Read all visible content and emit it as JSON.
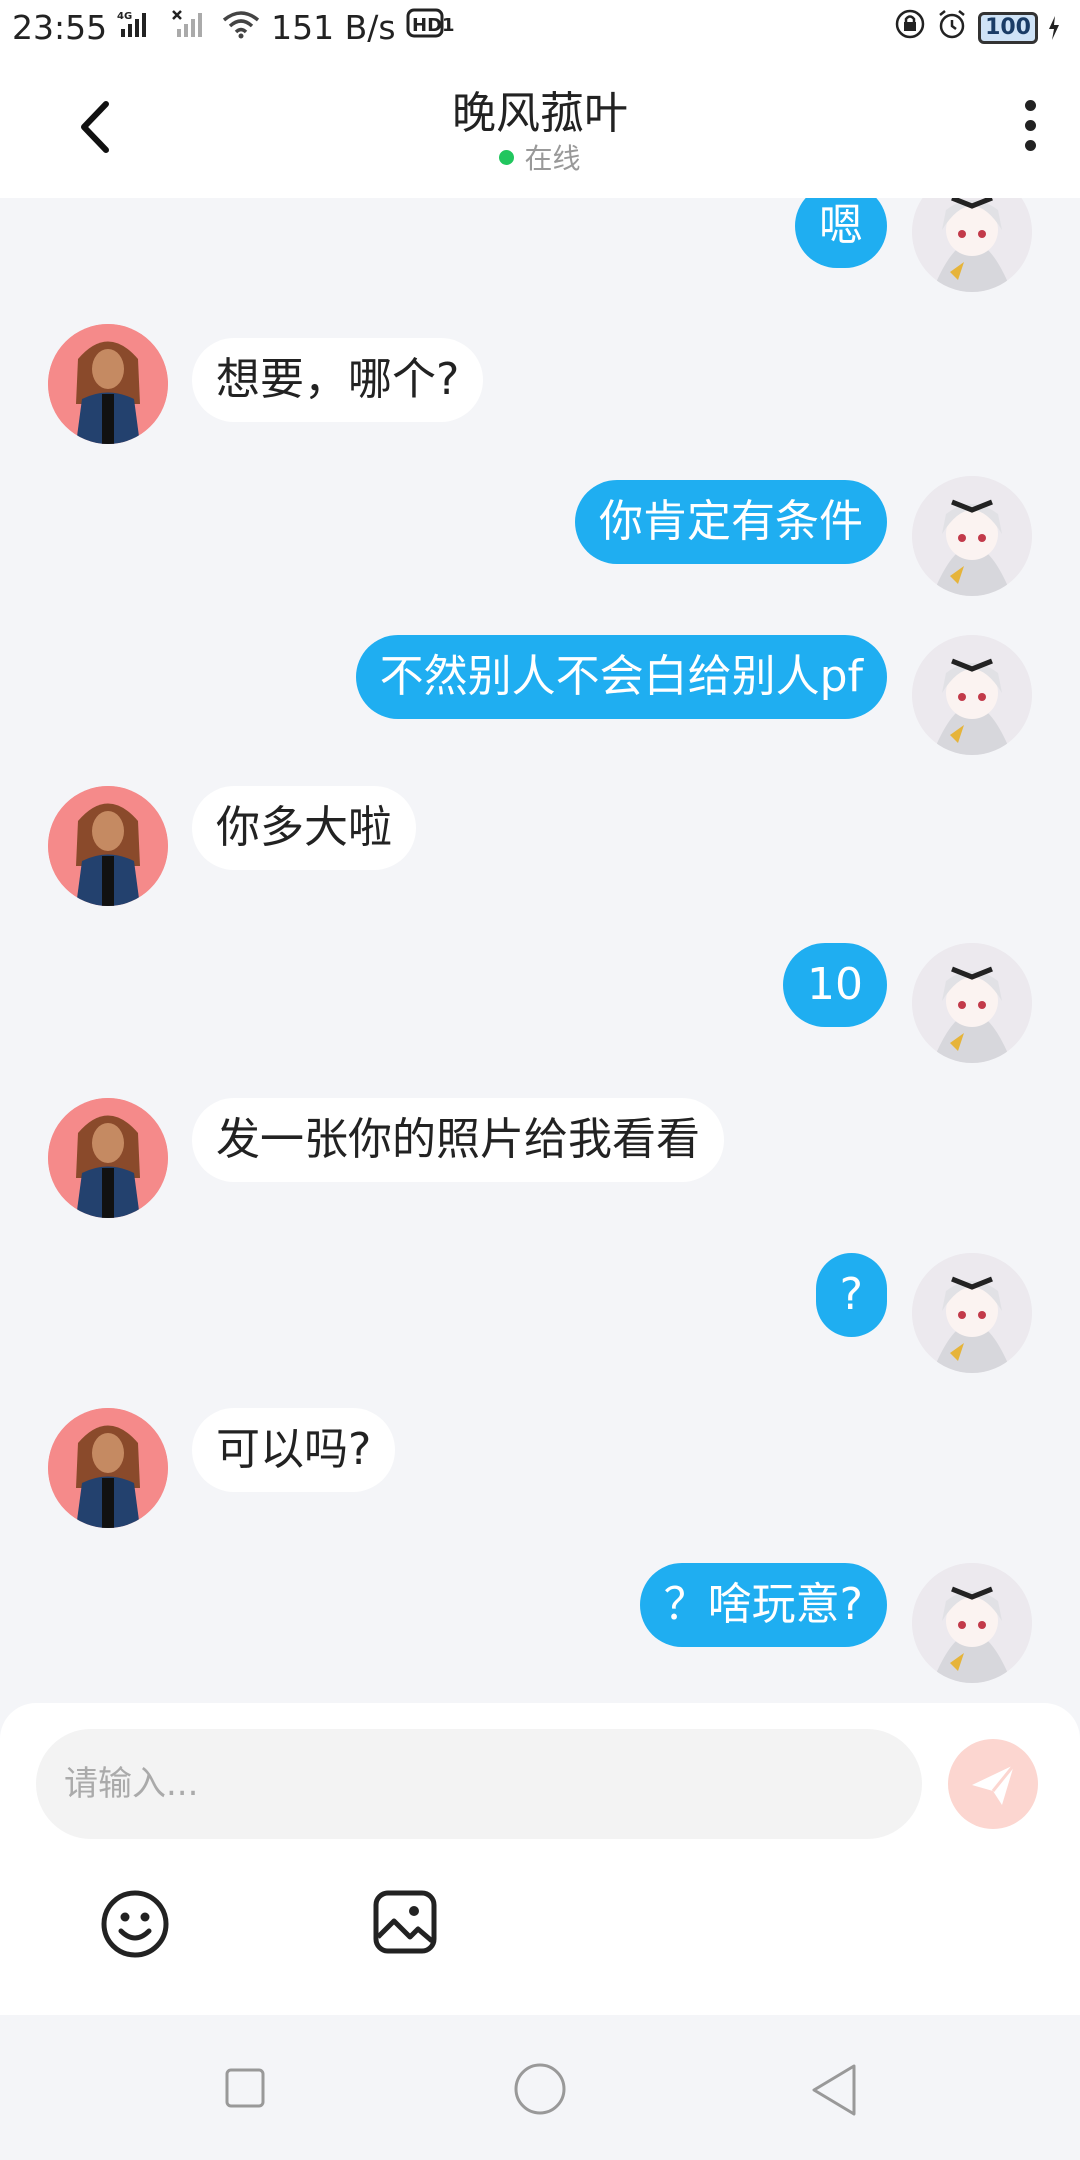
{
  "status_bar": {
    "time": "23:55",
    "network_label": "4G",
    "speed": "151 B/s",
    "hd_label": "HD1",
    "battery": "100"
  },
  "header": {
    "title": "晚风菰叶",
    "status": "在线"
  },
  "messages": [
    {
      "from": "me",
      "text": "嗯"
    },
    {
      "from": "them",
      "text": "想要，哪个?"
    },
    {
      "from": "me",
      "text": "你肯定有条件"
    },
    {
      "from": "me",
      "text": "不然别人不会白给别人pf"
    },
    {
      "from": "them",
      "text": "你多大啦"
    },
    {
      "from": "me",
      "text": "10"
    },
    {
      "from": "them",
      "text": "发一张你的照片给我看看"
    },
    {
      "from": "me",
      "text": "?"
    },
    {
      "from": "them",
      "text": "可以吗?"
    },
    {
      "from": "me",
      "text": "？啥玩意?"
    }
  ],
  "composer": {
    "placeholder": "请输入..."
  },
  "colors": {
    "accent": "#1faef1",
    "online": "#21c65e",
    "send_disabled": "#fcd6d0",
    "background": "#f4f5f8"
  },
  "icons": {
    "back": "chevron-left-icon",
    "more": "more-vertical-icon",
    "send": "paper-plane-icon",
    "emoji": "smiley-icon",
    "image": "image-icon"
  }
}
